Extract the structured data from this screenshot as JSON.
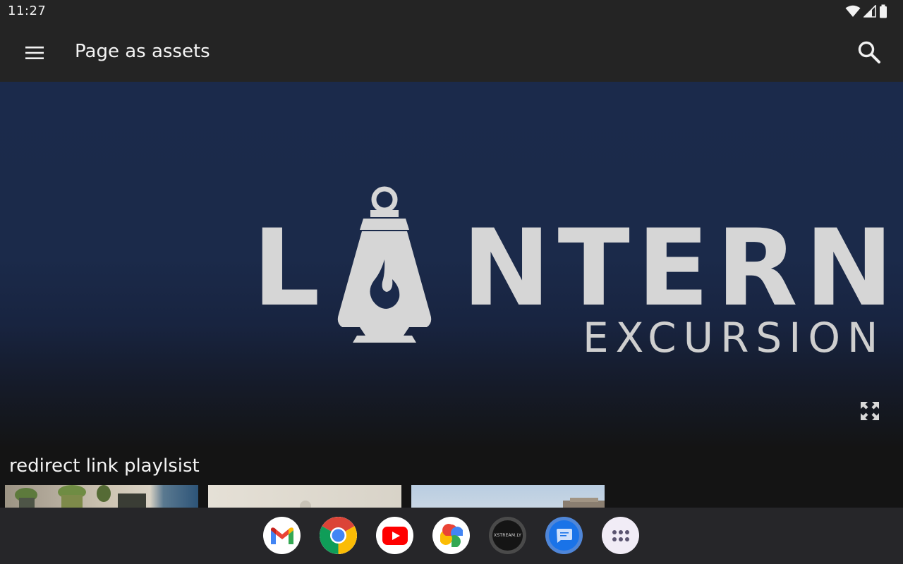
{
  "status_bar": {
    "time": "11:27"
  },
  "app_bar": {
    "title": "Page as assets",
    "menu_icon": "menu-icon",
    "search_icon": "search-icon"
  },
  "hero": {
    "brand_letter": "L",
    "brand_rest": "NTERN",
    "brand_sub": "EXCURSION",
    "background_color": "#1b2a4b",
    "logo_color": "#d6d6d6",
    "expand_icon": "fullscreen-icon"
  },
  "section": {
    "title": "redirect link playlsist",
    "thumbnails": [
      {
        "name": "thumbnail-plants"
      },
      {
        "name": "thumbnail-indoor"
      },
      {
        "name": "thumbnail-landscape"
      }
    ]
  },
  "taskbar": {
    "apps": [
      {
        "name": "gmail-icon"
      },
      {
        "name": "chrome-icon"
      },
      {
        "name": "youtube-icon"
      },
      {
        "name": "photos-icon"
      },
      {
        "name": "xstream-icon",
        "label": "XSTREAM.LY"
      },
      {
        "name": "messages-icon"
      },
      {
        "name": "app-drawer-icon"
      }
    ]
  }
}
